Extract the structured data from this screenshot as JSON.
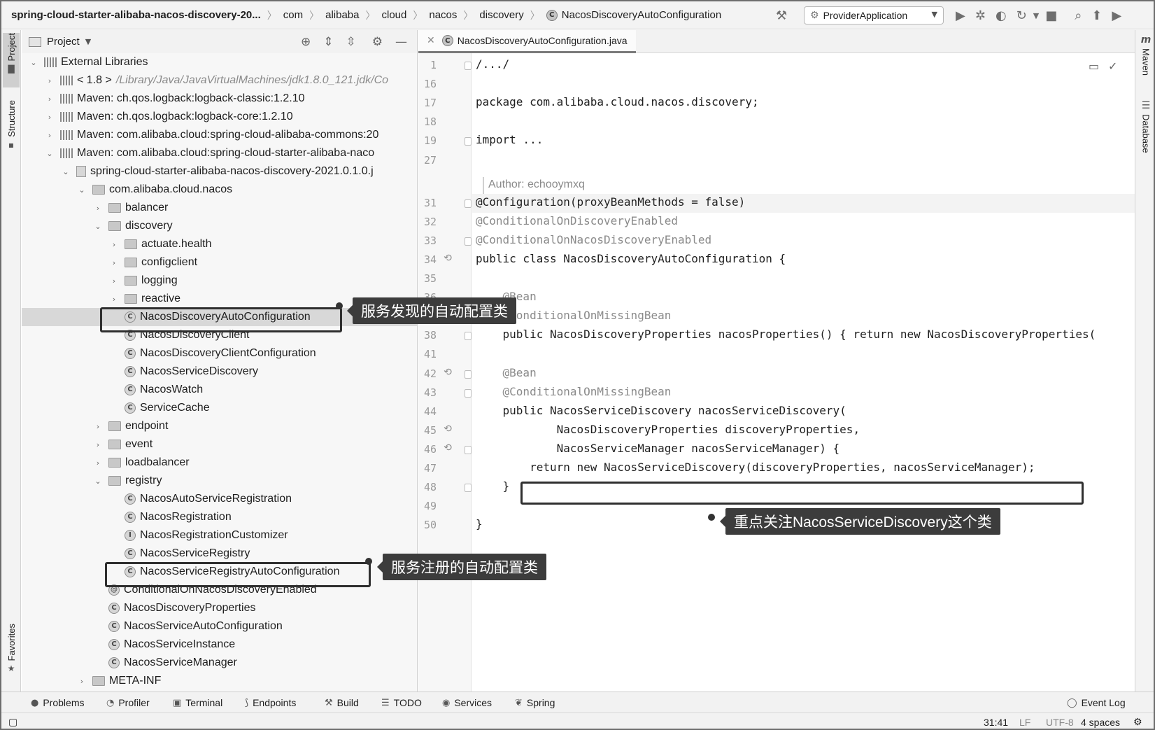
{
  "breadcrumb": {
    "root": "spring-cloud-starter-alibaba-nacos-discovery-20...",
    "items": [
      "com",
      "alibaba",
      "cloud",
      "nacos",
      "discovery"
    ],
    "current_class": "NacosDiscoveryAutoConfiguration",
    "class_icon_letter": "C"
  },
  "toolbar": {
    "run_config": "ProviderApplication",
    "icons": [
      "hammer-icon",
      "run-icon",
      "debug-icon",
      "coverage-icon",
      "profile-icon",
      "dropdown-icon",
      "stop-icon",
      "search-icon",
      "update-icon",
      "play-icon"
    ]
  },
  "left_strip": {
    "tabs": [
      "Project",
      "Structure",
      "Favorites"
    ]
  },
  "right_strip": {
    "tabs": [
      "Maven",
      "Database"
    ],
    "maven_glyph": "m"
  },
  "project_panel": {
    "title": "Project",
    "tree": [
      {
        "label": "External Libraries",
        "arrow": "down",
        "icon": "lib",
        "indent": 0
      },
      {
        "label": "< 1.8 >",
        "suffix": "/Library/Java/JavaVirtualMachines/jdk1.8.0_121.jdk/Co",
        "arrow": "right",
        "icon": "lib",
        "indent": 1
      },
      {
        "label": "Maven: ch.qos.logback:logback-classic:1.2.10",
        "arrow": "right",
        "icon": "lib",
        "indent": 1
      },
      {
        "label": "Maven: ch.qos.logback:logback-core:1.2.10",
        "arrow": "right",
        "icon": "lib",
        "indent": 1
      },
      {
        "label": "Maven: com.alibaba.cloud:spring-cloud-alibaba-commons:20",
        "arrow": "right",
        "icon": "lib",
        "indent": 1
      },
      {
        "label": "Maven: com.alibaba.cloud:spring-cloud-starter-alibaba-naco",
        "arrow": "down",
        "icon": "lib",
        "indent": 1
      },
      {
        "label": "spring-cloud-starter-alibaba-nacos-discovery-2021.0.1.0.j",
        "arrow": "down",
        "icon": "jar",
        "indent": 2
      },
      {
        "label": "com.alibaba.cloud.nacos",
        "arrow": "down",
        "icon": "folder",
        "indent": 3
      },
      {
        "label": "balancer",
        "arrow": "right",
        "icon": "folder",
        "indent": 4
      },
      {
        "label": "discovery",
        "arrow": "down",
        "icon": "folder",
        "indent": 4
      },
      {
        "label": "actuate.health",
        "arrow": "right",
        "icon": "folder",
        "indent": 5
      },
      {
        "label": "configclient",
        "arrow": "right",
        "icon": "folder",
        "indent": 5
      },
      {
        "label": "logging",
        "arrow": "right",
        "icon": "folder",
        "indent": 5
      },
      {
        "label": "reactive",
        "arrow": "right",
        "icon": "folder",
        "indent": 5
      },
      {
        "label": "NacosDiscoveryAutoConfiguration",
        "arrow": "none",
        "icon": "class",
        "indent": 5,
        "selected": true
      },
      {
        "label": "NacosDiscoveryClient",
        "arrow": "none",
        "icon": "class",
        "indent": 5
      },
      {
        "label": "NacosDiscoveryClientConfiguration",
        "arrow": "none",
        "icon": "class",
        "indent": 5
      },
      {
        "label": "NacosServiceDiscovery",
        "arrow": "none",
        "icon": "class",
        "indent": 5
      },
      {
        "label": "NacosWatch",
        "arrow": "none",
        "icon": "class",
        "indent": 5
      },
      {
        "label": "ServiceCache",
        "arrow": "none",
        "icon": "class",
        "indent": 5
      },
      {
        "label": "endpoint",
        "arrow": "right",
        "icon": "folder",
        "indent": 4
      },
      {
        "label": "event",
        "arrow": "right",
        "icon": "folder",
        "indent": 4
      },
      {
        "label": "loadbalancer",
        "arrow": "right",
        "icon": "folder",
        "indent": 4
      },
      {
        "label": "registry",
        "arrow": "down",
        "icon": "folder",
        "indent": 4
      },
      {
        "label": "NacosAutoServiceRegistration",
        "arrow": "none",
        "icon": "class",
        "indent": 5
      },
      {
        "label": "NacosRegistration",
        "arrow": "none",
        "icon": "class",
        "indent": 5
      },
      {
        "label": "NacosRegistrationCustomizer",
        "arrow": "none",
        "icon": "interface",
        "indent": 5
      },
      {
        "label": "NacosServiceRegistry",
        "arrow": "none",
        "icon": "class",
        "indent": 5
      },
      {
        "label": "NacosServiceRegistryAutoConfiguration",
        "arrow": "none",
        "icon": "class",
        "indent": 5
      },
      {
        "label": "ConditionalOnNacosDiscoveryEnabled",
        "arrow": "none",
        "icon": "anno",
        "indent": 4
      },
      {
        "label": "NacosDiscoveryProperties",
        "arrow": "none",
        "icon": "class",
        "indent": 4
      },
      {
        "label": "NacosServiceAutoConfiguration",
        "arrow": "none",
        "icon": "class",
        "indent": 4
      },
      {
        "label": "NacosServiceInstance",
        "arrow": "none",
        "icon": "class",
        "indent": 4
      },
      {
        "label": "NacosServiceManager",
        "arrow": "none",
        "icon": "class",
        "indent": 4
      },
      {
        "label": "META-INF",
        "arrow": "right",
        "icon": "folder",
        "indent": 3
      }
    ]
  },
  "callouts": {
    "discovery_config": "服务发现的自动配置类",
    "registry_config": "服务注册的自动配置类",
    "focus_note": "重点关注NacosServiceDiscovery这个类"
  },
  "editor": {
    "tab_title": "NacosDiscoveryAutoConfiguration.java",
    "author": "Author: echooymxq",
    "lines": [
      {
        "n": "1",
        "text": "/.../",
        "fold": true
      },
      {
        "n": "16",
        "text": ""
      },
      {
        "n": "17",
        "text": "package com.alibaba.cloud.nacos.discovery;"
      },
      {
        "n": "18",
        "text": ""
      },
      {
        "n": "19",
        "text": "import ...",
        "fold": true
      },
      {
        "n": "27",
        "text": ""
      },
      {
        "n": "31",
        "text": "@Configuration(proxyBeanMethods = false)",
        "fold": true,
        "highlight": true
      },
      {
        "n": "32",
        "text": "@ConditionalOnDiscoveryEnabled",
        "anno": true
      },
      {
        "n": "33",
        "text": "@ConditionalOnNacosDiscoveryEnabled",
        "anno": true,
        "fold": true
      },
      {
        "n": "34",
        "text": "public class NacosDiscoveryAutoConfiguration {",
        "marker": true
      },
      {
        "n": "35",
        "text": ""
      },
      {
        "n": "36",
        "text": "    @Bean",
        "anno": true
      },
      {
        "n": "37",
        "text": "    @ConditionalOnMissingBean",
        "anno": true,
        "fold": true
      },
      {
        "n": "38",
        "text": "    public NacosDiscoveryProperties nacosProperties() { return new NacosDiscoveryProperties(",
        "fold": true
      },
      {
        "n": "41",
        "text": ""
      },
      {
        "n": "42",
        "text": "    @Bean",
        "anno": true,
        "marker": true,
        "fold": true
      },
      {
        "n": "43",
        "text": "    @ConditionalOnMissingBean",
        "anno": true,
        "fold": true
      },
      {
        "n": "44",
        "text": "    public NacosServiceDiscovery nacosServiceDiscovery("
      },
      {
        "n": "45",
        "text": "            NacosDiscoveryProperties discoveryProperties,",
        "marker": true
      },
      {
        "n": "46",
        "text": "            NacosServiceManager nacosServiceManager) {",
        "marker": true,
        "fold": true
      },
      {
        "n": "47",
        "text": "        return new NacosServiceDiscovery(discoveryProperties, nacosServiceManager);",
        "boxed": true
      },
      {
        "n": "48",
        "text": "    }",
        "fold": true
      },
      {
        "n": "49",
        "text": ""
      },
      {
        "n": "50",
        "text": "}"
      }
    ]
  },
  "bottom_tools": [
    "Problems",
    "Profiler",
    "Terminal",
    "Endpoints",
    "Build",
    "TODO",
    "Services",
    "Spring"
  ],
  "event_log": "Event Log",
  "status": {
    "position": "31:41",
    "line_sep": "LF",
    "encoding": "UTF-8",
    "indent": "4 spaces"
  }
}
